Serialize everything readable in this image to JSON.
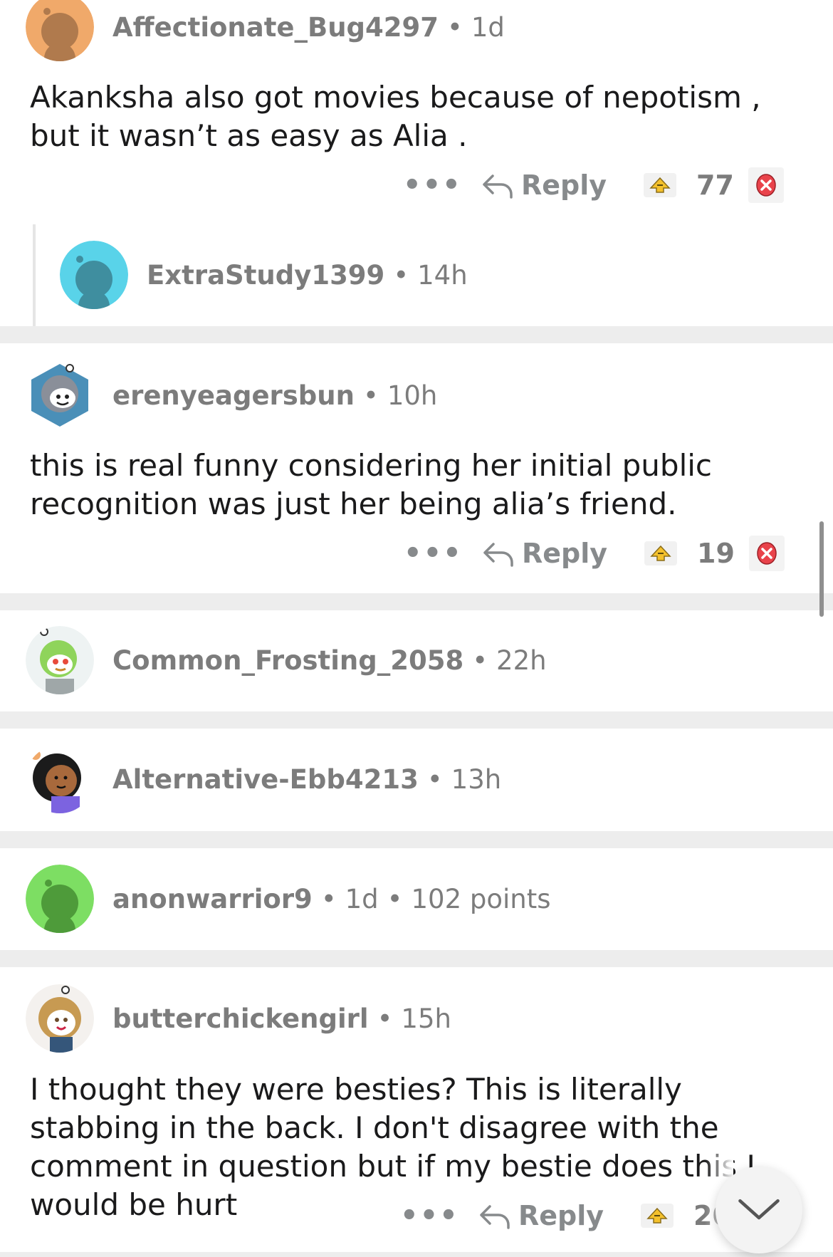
{
  "comments": [
    {
      "username": "Affectionate_Bug4297",
      "sep": "•",
      "age": "1d",
      "body": "Akanksha also got movies because of nepotism , but it wasn’t as easy as Alia .",
      "actions": {
        "more": "•••",
        "reply": "Reply",
        "score": "77"
      }
    },
    {
      "username": "ExtraStudy1399",
      "sep": "•",
      "age": "14h"
    },
    {
      "username": "erenyeagersbun",
      "sep": "•",
      "age": "10h",
      "body": "this is real funny considering her initial public recognition was just her being alia’s friend.",
      "actions": {
        "more": "•••",
        "reply": "Reply",
        "score": "19"
      }
    },
    {
      "username": "Common_Frosting_2058",
      "sep": "•",
      "age": "22h"
    },
    {
      "username": "Alternative-Ebb4213",
      "sep": "•",
      "age": "13h"
    },
    {
      "username": "anonwarrior9",
      "sep": "•",
      "age": "1d",
      "points": "102 points"
    },
    {
      "username": "butterchickengirl",
      "sep": "•",
      "age": "15h",
      "body": "I thought they were besties? This is literally stabbing in the back. I don't disagree with the comment in question but if my bestie does this I would be hurt",
      "actions": {
        "more": "•••",
        "reply": "Reply",
        "score": "20"
      }
    }
  ],
  "colors": {
    "accent_orange": "#f0a96a",
    "cyan": "#59d3e9",
    "green": "#7dde63",
    "separator": "#ededed",
    "meta_gray": "#7c7c7c",
    "award_red": "#e9434b",
    "award_gold": "#f4c12c"
  },
  "icons": {
    "reply": "reply-arrow-icon",
    "upvote": "award-upvote-icon",
    "downvote": "close-circle-icon",
    "scroll_down": "chevron-down-icon"
  }
}
